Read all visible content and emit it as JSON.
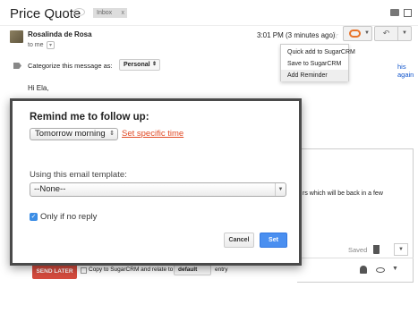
{
  "header": {
    "subject": "Price Quote",
    "label_inbox": "Inbox",
    "label_remove": "x"
  },
  "message": {
    "sender": "Rosalinda de Rosa",
    "to": "to me",
    "timestamp": "3:01 PM (3 minutes ago)",
    "greeting": "Hi Ela,",
    "snippet": "rs which will be back in a few"
  },
  "sugar_menu": {
    "items": [
      "Quick add to SugarCRM",
      "Save to SugarCRM",
      "Add Reminder"
    ]
  },
  "categorize": {
    "label": "Categorize this message as:",
    "value": "Personal",
    "link": "his again"
  },
  "compose": {
    "saved": "Saved",
    "send_later": "SEND LATER",
    "copy_text": "Copy to SugarCRM and relate to",
    "default_value": "default",
    "entry_text": "entry"
  },
  "reminder_dialog": {
    "title": "Remind me to follow up:",
    "time_value": "Tomorrow morning",
    "specific_time_link": "Set specific time",
    "template_label": "Using this email template:",
    "template_value": "--None--",
    "only_if_no_reply": "Only if no reply",
    "cancel_label": "Cancel",
    "set_label": "Set"
  },
  "colors": {
    "accent_blue": "#4a8ff0",
    "send_later_red": "#d44b3e",
    "link_orange": "#e04a25",
    "sugar_orange": "#e8742a"
  }
}
